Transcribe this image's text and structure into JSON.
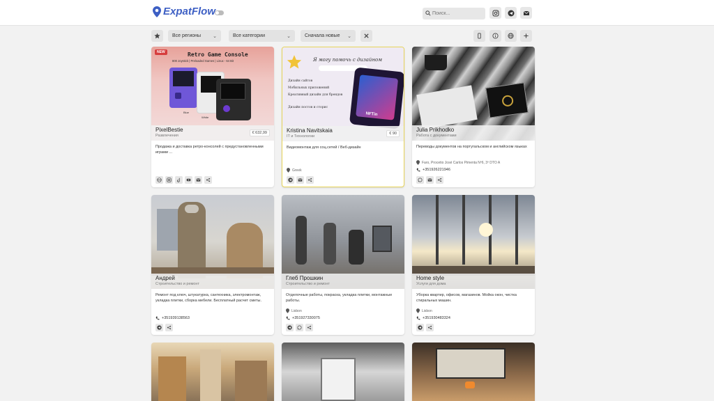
{
  "header": {
    "app_name": "ExpatFlow",
    "search_placeholder": "Поиск...",
    "icons": [
      "instagram-icon",
      "telegram-icon",
      "mail-icon"
    ]
  },
  "filters": {
    "region": "Все регионы",
    "category": "Все категории",
    "sort": "Сначала новые"
  },
  "cards": [
    {
      "name": "PixelBestie",
      "category": "Развлечения",
      "price": "€ 632,99",
      "badge": "NEW",
      "image_title": "Retro Game Console",
      "image_subtitle": "800 Joystick | Preloaded Games | Linux - 64 Bit",
      "image_color_1": "Blue",
      "image_color_2": "White",
      "description": "Продажа и доставка ретро-консолей с предустановленными играми ...",
      "actions": [
        "globe-icon",
        "instagram-icon",
        "tiktok-icon",
        "youtube-icon",
        "mail-icon",
        "share-icon"
      ]
    },
    {
      "name": "Kristina Navitskaia",
      "category": "IT и Технологии",
      "price": "€ 90",
      "image_title": "Я могу помочь с дизайном",
      "image_lines": [
        "Дизайн сайтов",
        "Мобильных приложений",
        "Креативный дизайн для брендов",
        "Дизайн постов и сторис"
      ],
      "image_phone_text": "NFTin",
      "description": "Видеомонтаж для соц.сетей / Веб-дизайн",
      "location": "Greek",
      "actions": [
        "telegram-icon",
        "mail-icon",
        "share-icon"
      ]
    },
    {
      "name": "Julia Prikhodko",
      "category": "Работа с документами",
      "description": "Переводы документов на португальском и английском языках",
      "location": "Faro, Procetio José Carlos Pimenta Nº6, 3º DTO A",
      "phone": "+351926221946",
      "actions": [
        "whatsapp-icon",
        "mail-icon",
        "share-icon"
      ]
    },
    {
      "name": "Андрей",
      "category": "Строительство и ремонт",
      "description": "Ремонт под ключ, штукатурка, сантехника, электромонтаж, укладка плитки, сборка мебели. Бесплатный расчет сметы.",
      "phone": "+351939138563",
      "actions": [
        "telegram-icon",
        "share-icon"
      ]
    },
    {
      "name": "Глеб Прошкин",
      "category": "Строительство и ремонт",
      "description": "Отделочные работы, покраска, укладка плитки, монтажные работы.",
      "location": "Lisbon",
      "phone": "+351927330075",
      "actions": [
        "telegram-icon",
        "whatsapp-icon",
        "share-icon"
      ]
    },
    {
      "name": "Home style",
      "category": "Услуги для дома",
      "description": "Уборка квартир, офисов, магазинов. Мойка окон, чистка стиральных машин.",
      "location": "Lisbon",
      "phone": "+351930483324",
      "actions": [
        "telegram-icon",
        "share-icon"
      ]
    }
  ]
}
